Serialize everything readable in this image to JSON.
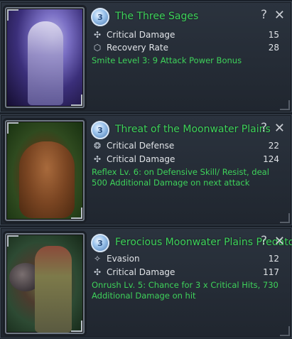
{
  "panels": [
    {
      "grade": "3",
      "title": "The Three Sages",
      "stats": [
        {
          "icon": "critical-damage-icon",
          "name": "Critical Damage",
          "value": "15"
        },
        {
          "icon": "recovery-rate-icon",
          "name": "Recovery Rate",
          "value": "28"
        }
      ],
      "description": "Smite Level 3: 9 Attack Power Bonus"
    },
    {
      "grade": "3",
      "title": "Threat of the Moonwater Plains",
      "stats": [
        {
          "icon": "critical-defense-icon",
          "name": "Critical Defense",
          "value": "22"
        },
        {
          "icon": "critical-damage-icon",
          "name": "Critical Damage",
          "value": "124"
        }
      ],
      "description": "Reflex Lv. 6: on Defensive Skill/ Resist, deal 500 Additional Damage on next attack"
    },
    {
      "grade": "3",
      "title": "Ferocious Moonwater Plains Predator",
      "stats": [
        {
          "icon": "evasion-icon",
          "name": "Evasion",
          "value": "12"
        },
        {
          "icon": "critical-damage-icon",
          "name": "Critical Damage",
          "value": "117"
        }
      ],
      "description": "Onrush Lv. 5: Chance for 3 x Critical Hits, 730 Additional Damage on hit"
    }
  ],
  "help_symbol": "?",
  "close_symbol": "✕",
  "colors": {
    "accent_green": "#3ed25a",
    "stat_text": "#e1e4e8",
    "panel_bg": "#252c36"
  }
}
